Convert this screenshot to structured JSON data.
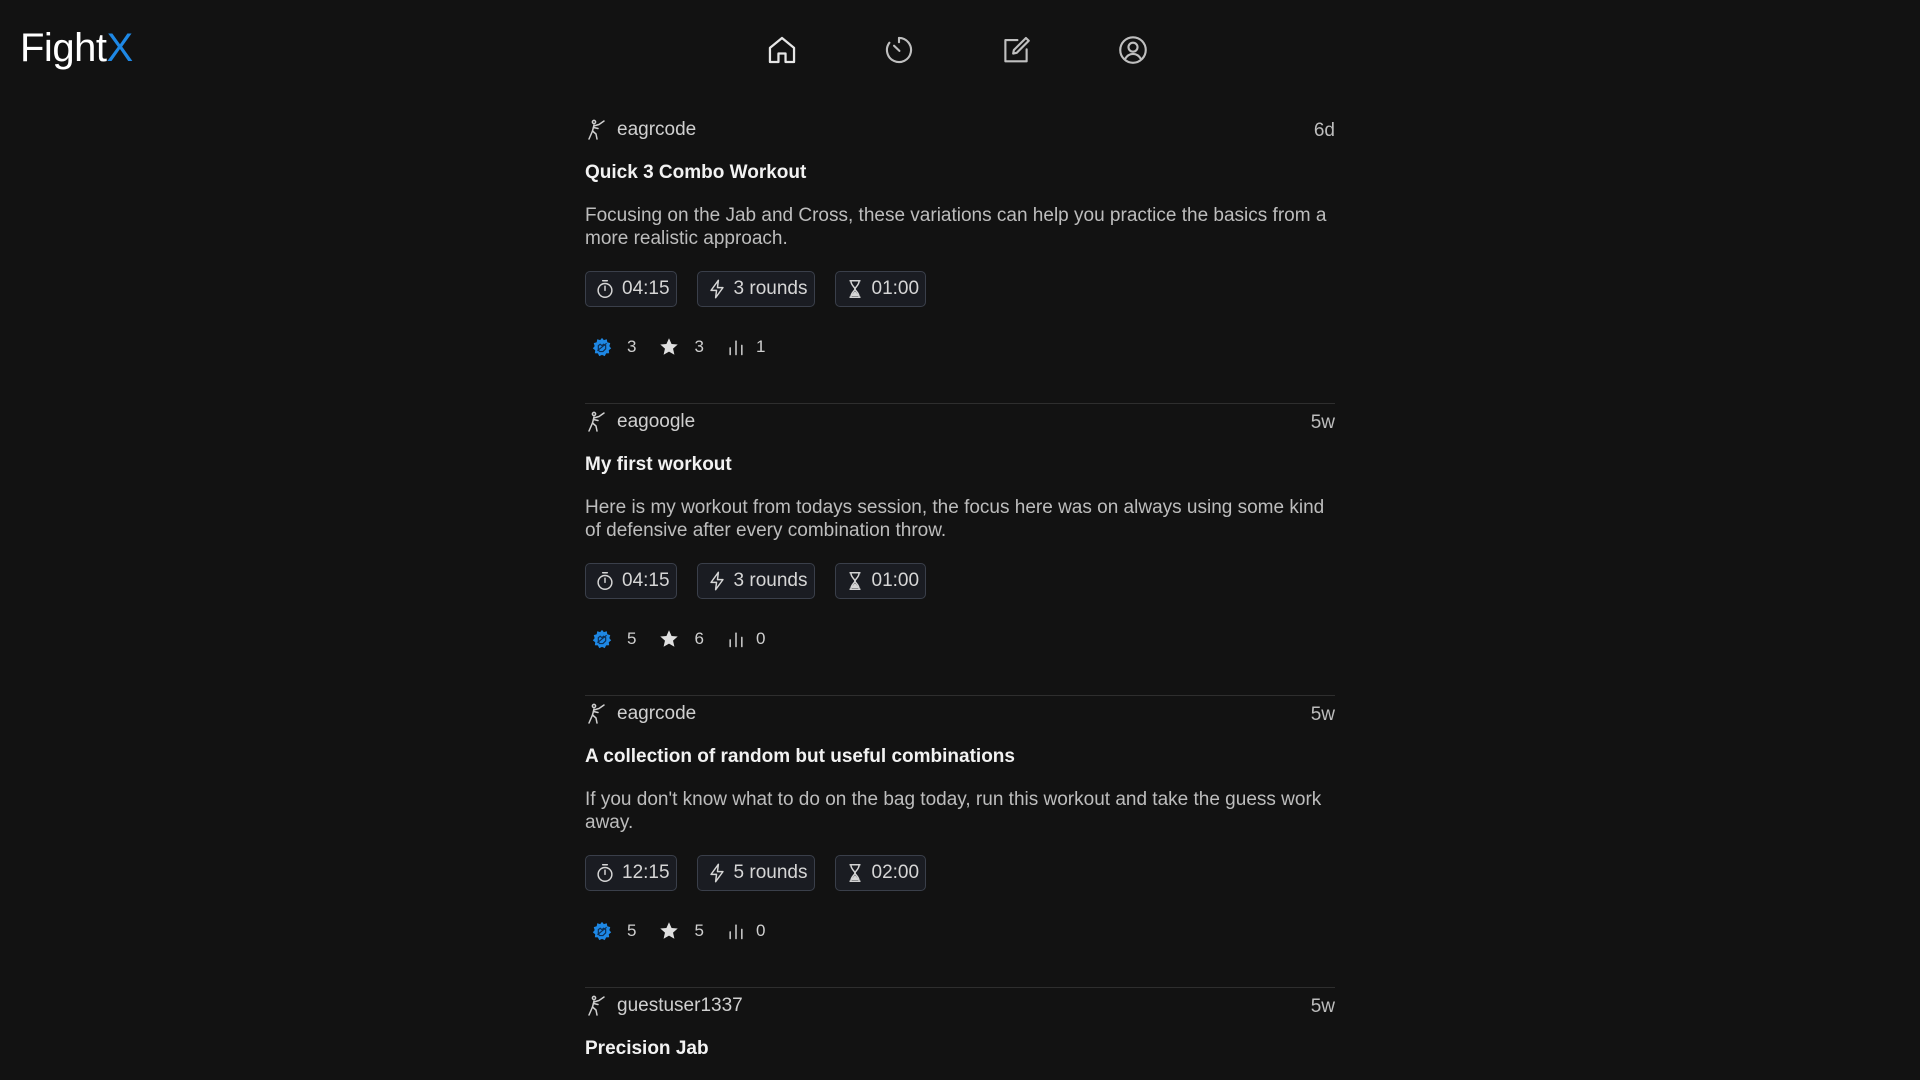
{
  "app": {
    "logo_main": "Fight",
    "logo_accent": "X",
    "accent_color": "#1e88e5"
  },
  "nav": [
    {
      "icon": "home-icon"
    },
    {
      "icon": "timer-icon"
    },
    {
      "icon": "edit-icon"
    },
    {
      "icon": "account-icon"
    }
  ],
  "posts": [
    {
      "author": "eagrcode",
      "age": "6d",
      "title": "Quick 3 Combo Workout",
      "description": "Focusing on the Jab and Cross, these variations can help you practice the basics from a more realistic approach.",
      "duration": "04:15",
      "rounds": "3 rounds",
      "rest": "01:00",
      "likes": "3",
      "stars": "3",
      "plays": "1"
    },
    {
      "author": "eagoogle",
      "age": "5w",
      "title": "My first workout",
      "description": "Here is my workout from todays session, the focus here was on always using some kind of defensive after every combination throw.",
      "duration": "04:15",
      "rounds": "3 rounds",
      "rest": "01:00",
      "likes": "5",
      "stars": "6",
      "plays": "0"
    },
    {
      "author": "eagrcode",
      "age": "5w",
      "title": "A collection of random but useful combinations",
      "description": "If you don't know what to do on the bag today, run this workout and take the guess work away.",
      "duration": "12:15",
      "rounds": "5 rounds",
      "rest": "02:00",
      "likes": "5",
      "stars": "5",
      "plays": "0"
    },
    {
      "author": "guestuser1337",
      "age": "5w",
      "title": "Precision Jab"
    }
  ]
}
